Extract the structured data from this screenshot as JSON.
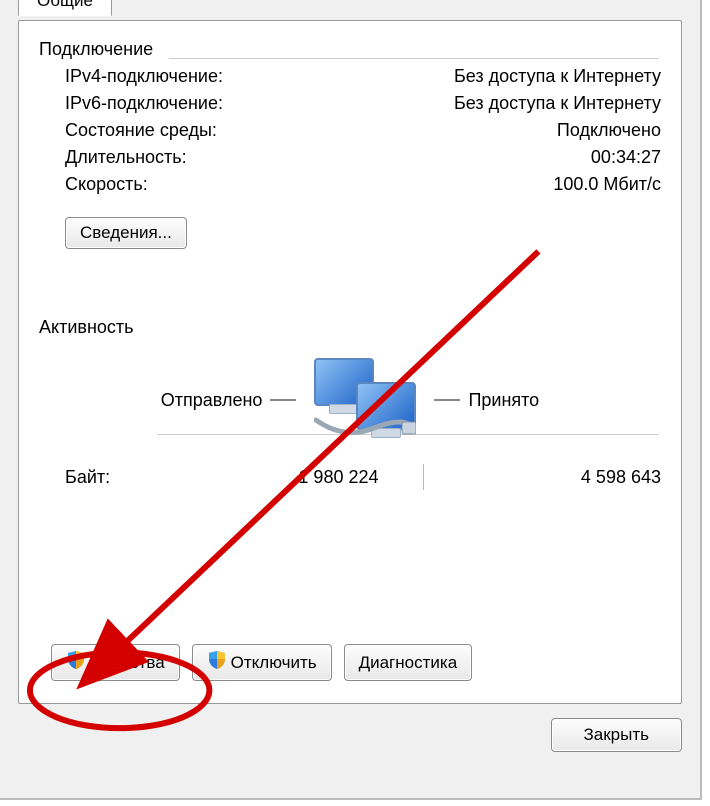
{
  "tab": {
    "label": "Общие"
  },
  "connection": {
    "title": "Подключение",
    "rows": [
      {
        "label": "IPv4-подключение:",
        "value": "Без доступа к Интернету"
      },
      {
        "label": "IPv6-подключение:",
        "value": "Без доступа к Интернету"
      },
      {
        "label": "Состояние среды:",
        "value": "Подключено"
      },
      {
        "label": "Длительность:",
        "value": "00:34:27"
      },
      {
        "label": "Скорость:",
        "value": "100.0 Мбит/с"
      }
    ],
    "details_button": "Сведения..."
  },
  "activity": {
    "title": "Активность",
    "sent_label": "Отправлено",
    "received_label": "Принято",
    "bytes_label": "Байт:",
    "bytes_sent": "1 980 224",
    "bytes_received": "4 598 643"
  },
  "buttons": {
    "properties": "Свойства",
    "disable": "Отключить",
    "diagnose": "Диагностика",
    "close": "Закрыть"
  }
}
